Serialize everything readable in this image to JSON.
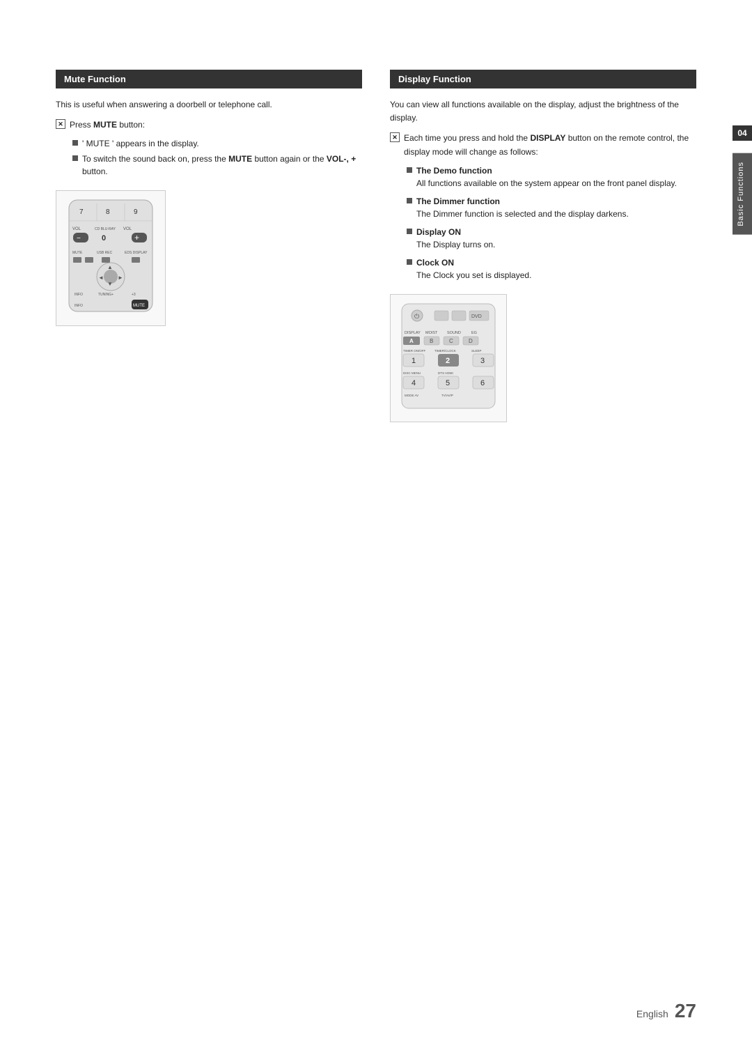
{
  "page": {
    "chapter_number": "04",
    "chapter_label": "Basic Functions",
    "footer_text": "English",
    "footer_page": "27"
  },
  "mute_section": {
    "header": "Mute Function",
    "intro": "This is useful when answering a doorbell or telephone call.",
    "step1_label": "Press ",
    "step1_bold": "MUTE",
    "step1_suffix": " button:",
    "sub_items": [
      "' MUTE ' appears in the display.",
      "To switch the sound back on, press the MUTE button again or the VOL-, + button."
    ],
    "sub_item_bold_1": "MUTE",
    "sub_item_bold_2": "VOL-, +"
  },
  "display_section": {
    "header": "Display Function",
    "intro": "You can view all functions available on the display, adjust the brightness of the display.",
    "step1_prefix": "Each time you press and hold the ",
    "step1_bold": "DISPLAY",
    "step1_suffix": " button on the remote control, the display mode will change as follows:",
    "features": [
      {
        "title": "The Demo function",
        "desc": "All functions available on the system appear on the front panel display."
      },
      {
        "title": "The Dimmer function",
        "desc": "The Dimmer function is selected and the display darkens."
      },
      {
        "title": "Display ON",
        "desc": "The Display turns on."
      },
      {
        "title": "Clock ON",
        "desc": "The Clock you set is displayed."
      }
    ]
  }
}
